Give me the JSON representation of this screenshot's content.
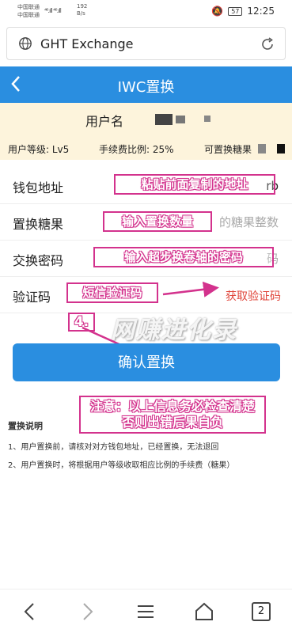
{
  "status": {
    "carrier1": "中国联通",
    "carrier2": "中国联通",
    "signal": "⁴⁶.ıll ⁴⁶.ıll",
    "speed_value": "192",
    "speed_unit": "B/s",
    "battery": "57",
    "time": "12:25"
  },
  "browser": {
    "title": "GHT Exchange"
  },
  "header": {
    "title": "IWC置换"
  },
  "user": {
    "label": "用户名"
  },
  "info": {
    "level": "用户等级: Lv5",
    "fee": "手续费比例: 25%",
    "candy": "可置换糖果"
  },
  "form": {
    "wallet_label": "钱包地址",
    "wallet_value": "rb",
    "candy_label": "置换糖果",
    "candy_placeholder": "的糖果整数",
    "password_label": "交换密码",
    "password_placeholder": "码",
    "code_label": "验证码",
    "get_code": "获取验证码"
  },
  "annotations": {
    "wallet": "粘贴前面复制的地址",
    "candy": "输入置换数量",
    "password": "输入超步换卷轴的密码",
    "code": "短信验证码",
    "step": "4.",
    "warning_line1": "注意：以上信息务必检查清楚",
    "warning_line2": "否则出错后果自负",
    "watermark": "网赚进化录"
  },
  "confirm_button": "确认置换",
  "notes": {
    "title": "置换说明",
    "item1": "1、用户置换前，请核对对方钱包地址，已经置换，无法退回",
    "item2": "2、用户置换时，将根据用户等级收取相应比例的手续费（糖果）"
  },
  "navbar": {
    "tabs_count": "2"
  },
  "colors": {
    "primary": "#2a8ee0",
    "info_bg": "#fdf4dc",
    "annotation": "#d3328d",
    "link": "#e0453a"
  }
}
